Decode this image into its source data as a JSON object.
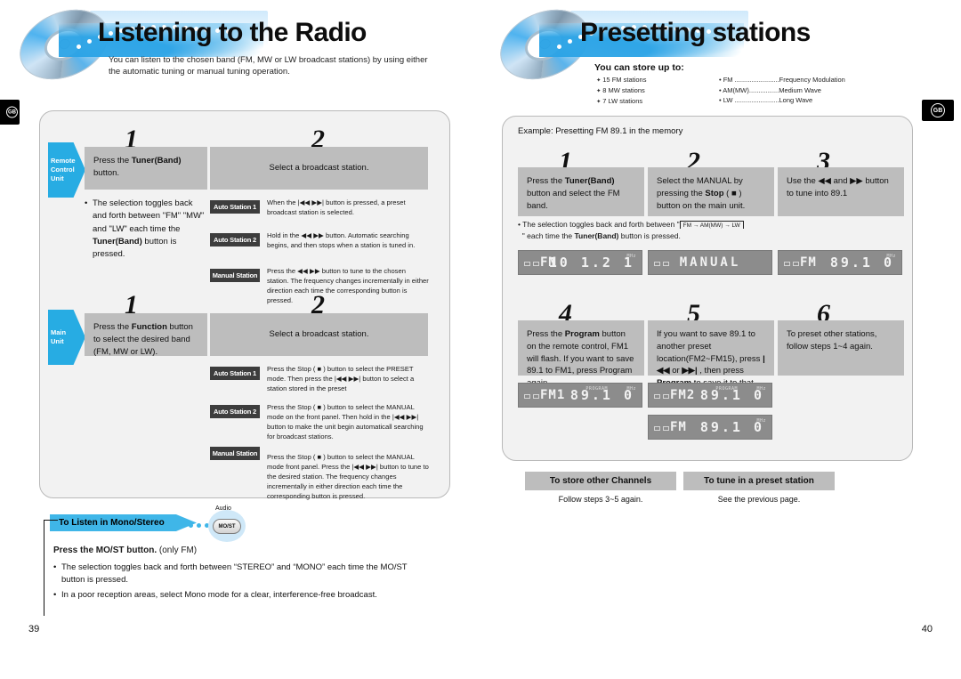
{
  "left_page": {
    "title": "Listening to the Radio",
    "subtitle": "You can listen to the chosen band (FM, MW or LW broadcast stations) by using either the automatic tuning or manual tuning operation.",
    "page_number": "39",
    "edge_tab_label": "GB",
    "remote_unit": {
      "arrow_label_line1": "Remote",
      "arrow_label_line2": "Control",
      "arrow_label_line3": "Unit",
      "step1_number": "1",
      "step1_box": "Press the Tuner(Band) button.",
      "step1_box_bold": "Tuner(Band)",
      "step1_bullet": "The selection toggles back and forth between \"FM\" \"MW\" and \"LW\" each time the Tuner(Band) button is pressed.",
      "step2_number": "2",
      "step2_box": "Select a broadcast station.",
      "rows": [
        {
          "pill": "Auto Station 1",
          "text": "When the |◀◀ ▶▶| button is pressed, a preset broadcast station is selected."
        },
        {
          "pill": "Auto Station 2",
          "text": "Hold in the ◀◀ ▶▶ button. Automatic searching begins, and then stops when a station is tuned in."
        },
        {
          "pill": "Manual Station",
          "text": "Press the ◀◀ ▶▶ button to tune to the chosen station. The frequency changes incrementally in either direction each time the corresponding button is pressed."
        }
      ]
    },
    "main_unit": {
      "arrow_label_line1": "Main",
      "arrow_label_line2": "Unit",
      "step1_number": "1",
      "step1_box": "Press the Function button to select the desired band (FM, MW or LW).",
      "step1_box_bold": "Function",
      "step2_number": "2",
      "step2_box": "Select a broadcast station.",
      "rows": [
        {
          "pill": "Auto Station 1",
          "text": "Press the Stop ( ■ ) button to select the PRESET mode. Then press the |◀◀ ▶▶| button to select a station stored in the preset"
        },
        {
          "pill": "Auto Station 2",
          "text": "Press the Stop ( ■ ) button to select the MANUAL mode on the front panel. Then hold in the |◀◀ ▶▶| button to make the unit begin automaticall searching for broadcast stations."
        },
        {
          "pill": "Manual Station",
          "text": "Press the Stop ( ■ ) button to select the MANUAL mode front panel. Press the |◀◀ ▶▶| button to tune to the desired station. The frequency changes incrementally in either direction each time the corresponding button is pressed."
        }
      ]
    },
    "mono_stereo": {
      "tab_label": "To Listen in Mono/Stereo",
      "button_top_label": "Audio",
      "button_cap_label": "MO/ST",
      "heading_bold": "Press the MO/ST button.",
      "heading_rest": " (only FM)",
      "bullets": [
        "The selection toggles back and forth between “STEREO” and “MONO” each time the MO/ST button is pressed.",
        "In a poor reception areas, select Mono mode for a clear, interference-free broadcast."
      ]
    }
  },
  "right_page": {
    "title": "Presetting stations",
    "page_number": "40",
    "gb_badge_label": "GB",
    "store_title": "You can store up to:",
    "store_items": [
      "15 FM stations",
      "8 MW stations",
      "7 LW stations"
    ],
    "band_items": [
      "FM ........................Frequency Modulation",
      "AM(MW)................Medium Wave",
      "LW ........................Long Wave"
    ],
    "example_line": "Example: Presetting FM 89.1 in the memory",
    "steps_top": [
      {
        "number": "1",
        "text": "Press the Tuner(Band) button and select the FM band.",
        "bold": "Tuner(Band)"
      },
      {
        "number": "2",
        "text": "Select the MANUAL by pressing the Stop ( ■ ) button on the main unit.",
        "bold": "Stop"
      },
      {
        "number": "3",
        "text": "Use the ◀◀ and ▶▶ button to tune into 89.1",
        "bold": ""
      }
    ],
    "toggle_note_pre": "• The selection toggles back and forth between \"",
    "toggle_note_flow": "FM  →  AM(MW)  →  LW",
    "toggle_note_post": "\" each time the Tuner(Band) button is pressed.",
    "displays_top": [
      {
        "band": "FM",
        "freq": "10 1.2 1",
        "mini_right": "MHz",
        "program": ""
      },
      {
        "band": "MANUAL",
        "freq": "",
        "mini_right": "",
        "program": ""
      },
      {
        "band": "FM",
        "freq": "89.1 0",
        "mini_right": "MHz",
        "program": ""
      }
    ],
    "steps_bottom": [
      {
        "number": "4",
        "text": "Press the Program button on the remote control, FM1 will flash. If you want to save 89.1 to FM1, press Program again.",
        "bold": "Program"
      },
      {
        "number": "5",
        "text": "If you want to save 89.1 to another preset location(FM2~FM15), press |◀◀ or ▶▶| , then press Program to save it to that location.",
        "bold": "Program"
      },
      {
        "number": "6",
        "text": "To preset other stations, follow steps 1~4 again.",
        "bold": ""
      }
    ],
    "displays_bottom": [
      {
        "band": "FM1",
        "freq": "89.1 0",
        "mini_right": "MHz",
        "program": "PROGRAM"
      },
      {
        "band": "FM2",
        "freq": "89.1 0",
        "mini_right": "MHz",
        "program": "PROGRAM"
      },
      {
        "band": "FM",
        "freq": "89.1 0",
        "mini_right": "MHz",
        "program": ""
      }
    ],
    "footer_boxes": [
      {
        "title": "To store other Channels",
        "note": "Follow steps 3~5 again."
      },
      {
        "title": "To tune in a preset station",
        "note": "See the previous page."
      }
    ]
  },
  "colors": {
    "accent_blue": "#27ace3",
    "gray_box": "#bdbdbd",
    "pill_dark": "#3d3d3d",
    "panel_bg": "#f2f2f2",
    "lcd_bg": "#8c8c8c"
  }
}
